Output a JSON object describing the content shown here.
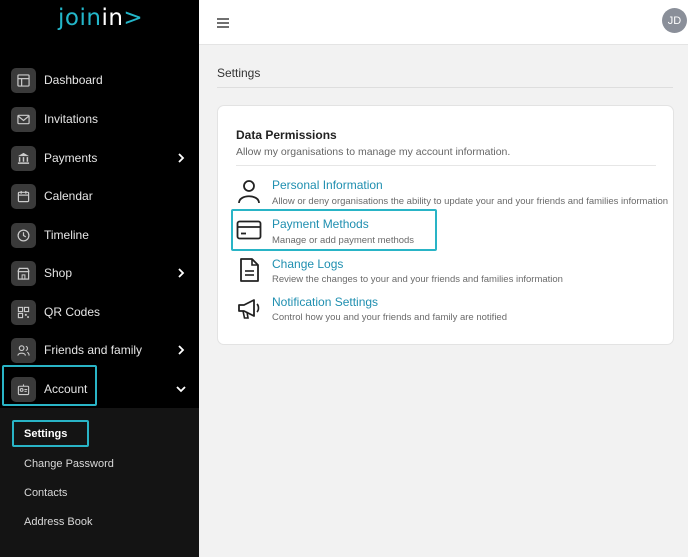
{
  "logo": {
    "join": "join",
    "in": "in",
    "arrow": ">"
  },
  "sidebar": {
    "items": [
      {
        "label": "Dashboard",
        "icon": "dashboard-icon"
      },
      {
        "label": "Invitations",
        "icon": "mail-icon"
      },
      {
        "label": "Payments",
        "icon": "bank-icon",
        "has_submenu": true
      },
      {
        "label": "Calendar",
        "icon": "calendar-icon"
      },
      {
        "label": "Timeline",
        "icon": "clock-icon"
      },
      {
        "label": "Shop",
        "icon": "shop-icon",
        "has_submenu": true
      },
      {
        "label": "QR Codes",
        "icon": "qr-code-icon"
      },
      {
        "label": "Friends and family",
        "icon": "people-icon",
        "has_submenu": true
      },
      {
        "label": "Account",
        "icon": "account-icon",
        "expanded": true
      }
    ],
    "account_subitems": [
      {
        "label": "Settings",
        "active": true
      },
      {
        "label": "Change Password"
      },
      {
        "label": "Contacts"
      },
      {
        "label": "Address Book"
      }
    ]
  },
  "topbar": {
    "avatar_initials": "JD"
  },
  "main": {
    "title": "Settings",
    "card": {
      "heading": "Data Permissions",
      "subheading": "Allow my organisations to manage my account information.",
      "items": [
        {
          "title": "Personal Information",
          "description": "Allow or deny organisations the ability to update your and your friends and families information",
          "icon": "person-icon"
        },
        {
          "title": "Payment Methods",
          "description": "Manage or add payment methods",
          "icon": "credit-card-icon",
          "highlighted": true
        },
        {
          "title": "Change Logs",
          "description": "Review the changes to your and your friends and families information",
          "icon": "document-icon"
        },
        {
          "title": "Notification Settings",
          "description": "Control how you and your friends and family are notified",
          "icon": "megaphone-icon"
        }
      ]
    }
  },
  "colors": {
    "accent": "#29b4c6",
    "link": "#1f8fb0",
    "sidebar_bg": "#000000",
    "subnav_bg": "#141414"
  }
}
